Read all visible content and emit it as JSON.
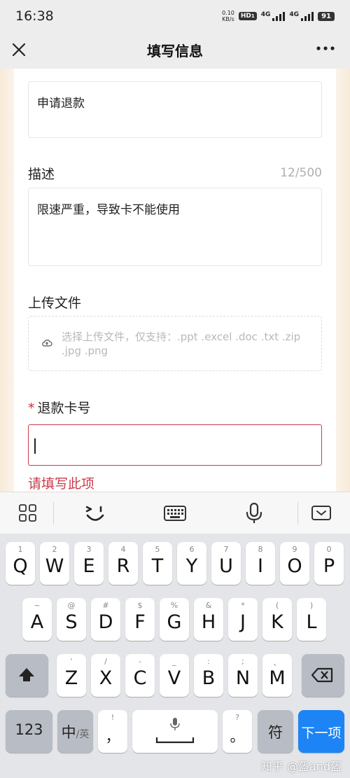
{
  "status_bar": {
    "time": "16:38",
    "net_speed_value": "0.10",
    "net_speed_unit": "KB/s",
    "hd_badge": "HD",
    "hd_sub": "1",
    "signal_1_label": "4G",
    "signal_2_label": "4G",
    "battery": "91"
  },
  "title_bar": {
    "title": "填写信息",
    "close_icon": "close-icon",
    "more_icon": "more-icon"
  },
  "form": {
    "refund_reason_value": "申请退款",
    "description_label": "描述",
    "description_counter": "12/500",
    "description_value": "限速严重，导致卡不能使用",
    "upload_label": "上传文件",
    "upload_placeholder": "选择上传文件，仅支持：.ppt .excel .doc .txt .zip .jpg .png",
    "refund_card_required_mark": "*",
    "refund_card_label": "退款卡号",
    "refund_card_value": "",
    "refund_card_error": "请填写此项",
    "error_color": "#c93a4a"
  },
  "keyboard_toolbar": {
    "items": [
      "grid-icon",
      "emoji-icon",
      "keyboard-icon",
      "mic-icon",
      "collapse-keyboard-icon"
    ]
  },
  "keyboard": {
    "row1": [
      {
        "hint": "1",
        "key": "Q"
      },
      {
        "hint": "2",
        "key": "W"
      },
      {
        "hint": "3",
        "key": "E"
      },
      {
        "hint": "4",
        "key": "R"
      },
      {
        "hint": "5",
        "key": "T"
      },
      {
        "hint": "6",
        "key": "Y"
      },
      {
        "hint": "7",
        "key": "U"
      },
      {
        "hint": "8",
        "key": "I"
      },
      {
        "hint": "9",
        "key": "O"
      },
      {
        "hint": "0",
        "key": "P"
      }
    ],
    "row2": [
      {
        "hint": "~",
        "key": "A"
      },
      {
        "hint": "@",
        "key": "S"
      },
      {
        "hint": "#",
        "key": "D"
      },
      {
        "hint": "$",
        "key": "F"
      },
      {
        "hint": "%",
        "key": "G"
      },
      {
        "hint": "&",
        "key": "H"
      },
      {
        "hint": "*",
        "key": "J"
      },
      {
        "hint": "(",
        "key": "K"
      },
      {
        "hint": ")",
        "key": "L"
      }
    ],
    "row3": [
      {
        "hint": "'",
        "key": "Z"
      },
      {
        "hint": "/",
        "key": "X"
      },
      {
        "hint": "-",
        "key": "C"
      },
      {
        "hint": "_",
        "key": "V"
      },
      {
        "hint": ":",
        "key": "B"
      },
      {
        "hint": ";",
        "key": "N"
      },
      {
        "hint": "、",
        "key": "M"
      }
    ],
    "numbers_key": "123",
    "lang_key_main": "中",
    "lang_key_sub": "/英",
    "comma_hint": "!",
    "comma_key": "，",
    "period_hint": "?",
    "period_key": "。",
    "symbol_key": "符",
    "next_key": "下一项",
    "accent_color": "#1c84f5"
  },
  "watermark": "知乎 @盔and盔"
}
